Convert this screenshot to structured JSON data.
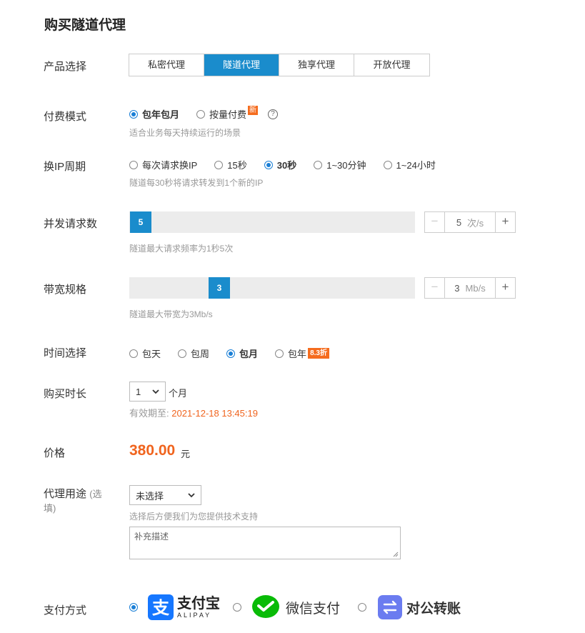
{
  "title": "购买隧道代理",
  "product": {
    "label": "产品选择",
    "tabs": [
      {
        "label": "私密代理",
        "active": false
      },
      {
        "label": "隧道代理",
        "active": true
      },
      {
        "label": "独享代理",
        "active": false
      },
      {
        "label": "开放代理",
        "active": false
      }
    ]
  },
  "billing": {
    "label": "付费模式",
    "options": [
      {
        "label": "包年包月",
        "checked": true
      },
      {
        "label": "按量付费",
        "checked": false,
        "badge": "新"
      }
    ],
    "help_icon": "?",
    "hint": "适合业务每天持续运行的场景"
  },
  "ip_cycle": {
    "label": "换IP周期",
    "options": [
      {
        "label": "每次请求换IP",
        "checked": false
      },
      {
        "label": "15秒",
        "checked": false
      },
      {
        "label": "30秒",
        "checked": true
      },
      {
        "label": "1~30分钟",
        "checked": false
      },
      {
        "label": "1~24小时",
        "checked": false
      }
    ],
    "hint": "隧道每30秒将请求转发到1个新的IP"
  },
  "concurrency": {
    "label": "并发请求数",
    "value": "5",
    "slider_fraction": 0.0,
    "unit": "次/s",
    "hint": "隧道最大请求频率为1秒5次"
  },
  "bandwidth": {
    "label": "带宽规格",
    "value": "3",
    "slider_fraction": 0.3,
    "unit": "Mb/s",
    "hint": "隧道最大带宽为3Mb/s"
  },
  "time_choice": {
    "label": "时间选择",
    "options": [
      {
        "label": "包天",
        "checked": false
      },
      {
        "label": "包周",
        "checked": false
      },
      {
        "label": "包月",
        "checked": true
      },
      {
        "label": "包年",
        "checked": false,
        "badge": "8.3折"
      }
    ]
  },
  "duration": {
    "label": "购买时长",
    "value": "1",
    "unit": "个月",
    "expiry_label": "有效期至:",
    "expiry_value": "2021-12-18 13:45:19"
  },
  "price": {
    "label": "价格",
    "value": "380.00",
    "unit": "元"
  },
  "usage": {
    "label": "代理用途",
    "label_suffix": "(选",
    "label_suffix2": "填)",
    "select_value": "未选择",
    "hint": "选择后方便我们为您提供技术支持",
    "textarea_placeholder": "补充描述"
  },
  "payment": {
    "label": "支付方式",
    "options": [
      {
        "name": "支付宝",
        "sub": "ALIPAY",
        "checked": true,
        "icon": "alipay-icon",
        "color": "#1677ff"
      },
      {
        "name": "微信支付",
        "checked": false,
        "icon": "wechat-pay-icon",
        "color": "#09bb07"
      },
      {
        "name": "对公转账",
        "checked": false,
        "icon": "bank-transfer-icon",
        "color": "#6b7cf0"
      }
    ]
  },
  "colors": {
    "accent": "#1a8ccc",
    "radio": "#1a7fd6",
    "price": "#f0641e",
    "badge": "#f56c1e"
  }
}
